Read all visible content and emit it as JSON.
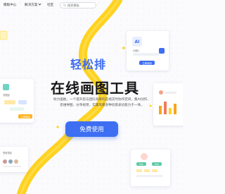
{
  "nav": {
    "logo_text": "模板中心",
    "solutions_label": "解决方案",
    "community_label": "社区",
    "search_placeholder": "搜索模板"
  },
  "hero": {
    "title_line1": "轻松排",
    "title_line2": "在线画图工具",
    "description_line1": "防力画板，一个提升您与团队效率的在线实时协作空间，集AI创作、",
    "description_line2": "思维导图、分布视觉、实属风暴多种创意表达能力于一体。",
    "cta_label": "免费使用"
  },
  "cards": {
    "ai_card": {
      "badge": "AI",
      "caption": "AI图片",
      "button_label": "立即使用"
    },
    "left_card": {
      "caption": "流程图",
      "button_label": "立即使用"
    },
    "bottom_left_card": {
      "caption": "思维导图"
    },
    "bottom_right_card": {
      "tag_a": "Ext",
      "tag_b": "Ext"
    }
  },
  "colors": {
    "brand_blue": "#3e6ff2",
    "swoosh_yellow": "#ffd21f",
    "accent_orange": "#f5a623"
  },
  "icons": [
    "search-icon",
    "chevron-down-icon",
    "ai-icon"
  ]
}
